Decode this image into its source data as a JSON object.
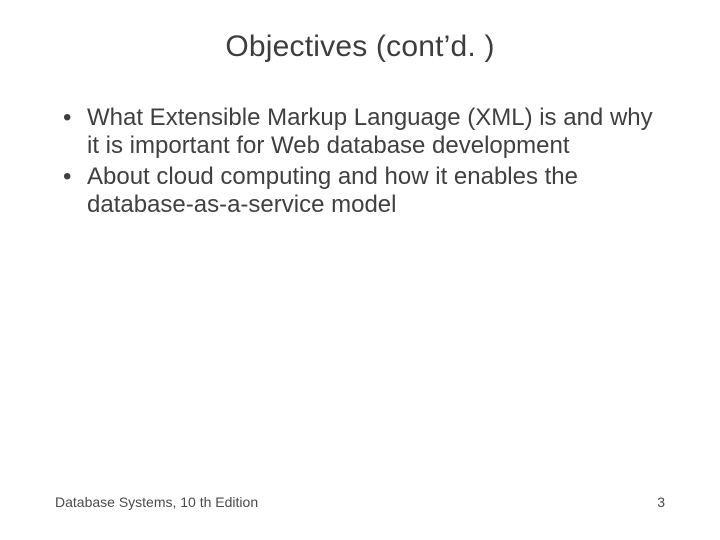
{
  "title": "Objectives (cont’d. )",
  "bullets": [
    "What Extensible Markup Language (XML) is and why it is important for Web database development",
    "About cloud computing and how it enables the database-as-a-service model"
  ],
  "footer": {
    "source": "Database Systems, 10 th Edition",
    "page": "3"
  }
}
